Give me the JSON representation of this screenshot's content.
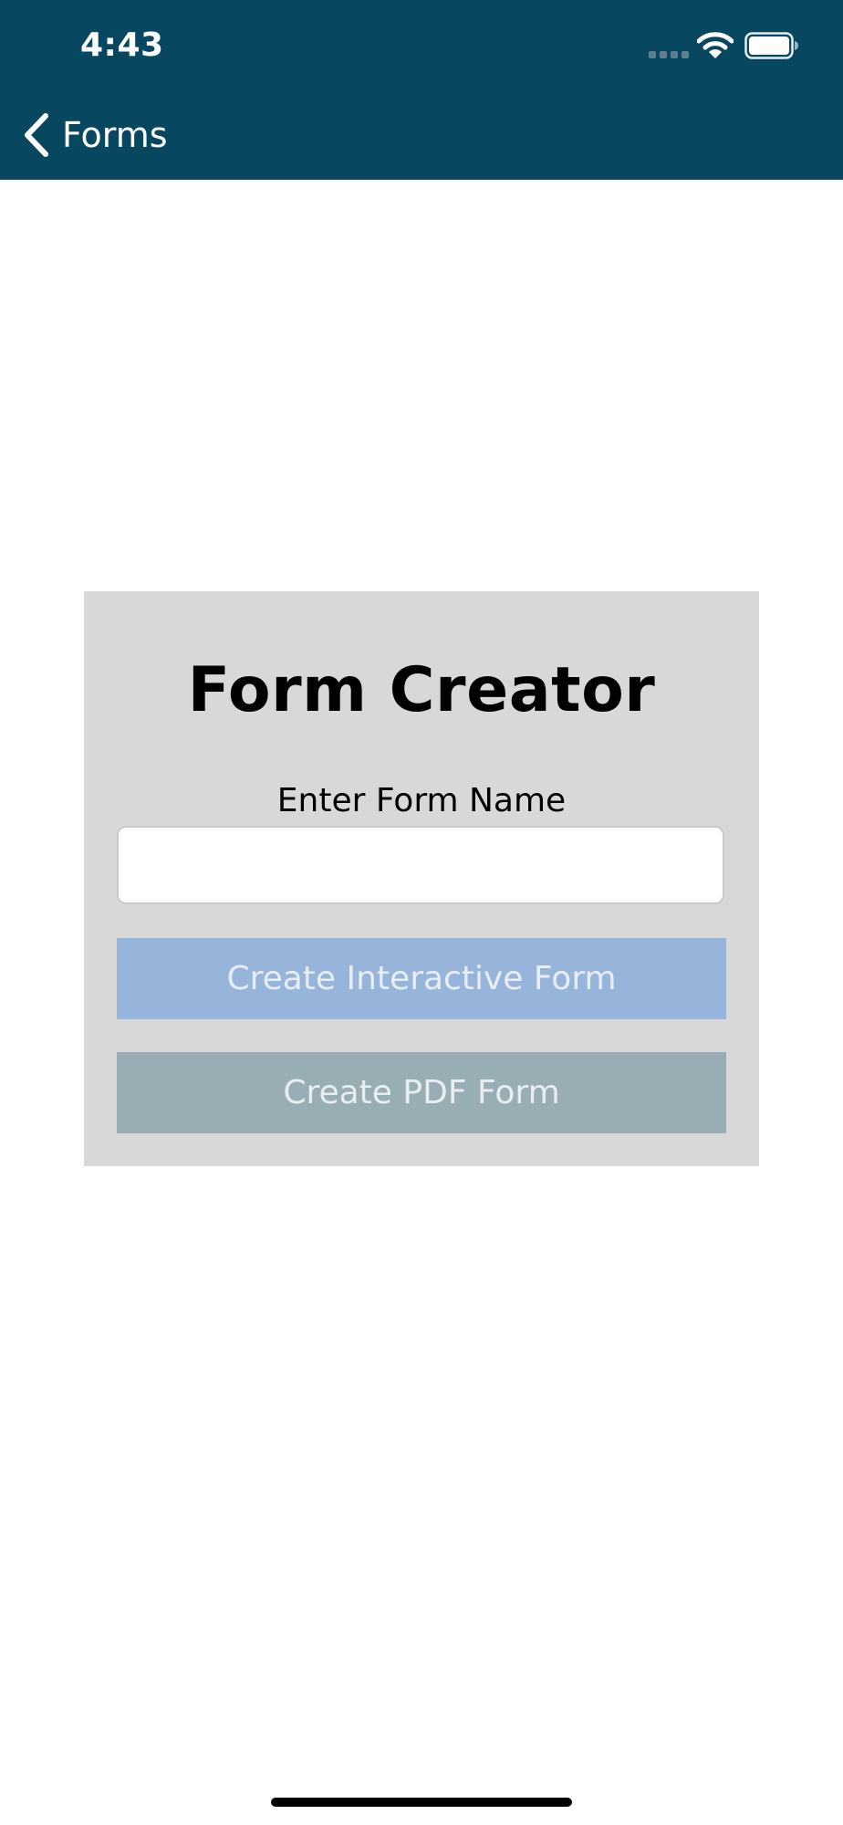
{
  "status_bar": {
    "time": "4:43",
    "icons": [
      "cellular-signal-icon",
      "wifi-icon",
      "battery-icon"
    ]
  },
  "nav": {
    "back_icon": "chevron-left-icon",
    "back_label": "Forms"
  },
  "form_card": {
    "title": "Form Creator",
    "field_label": "Enter Form Name",
    "name_input_value": "",
    "buttons": {
      "interactive": "Create Interactive Form",
      "pdf": "Create PDF Form"
    }
  },
  "colors": {
    "nav_background": "#084760",
    "card_background": "#d8d8d8",
    "interactive_button": "#97b5da",
    "pdf_button": "#98aeb4"
  }
}
